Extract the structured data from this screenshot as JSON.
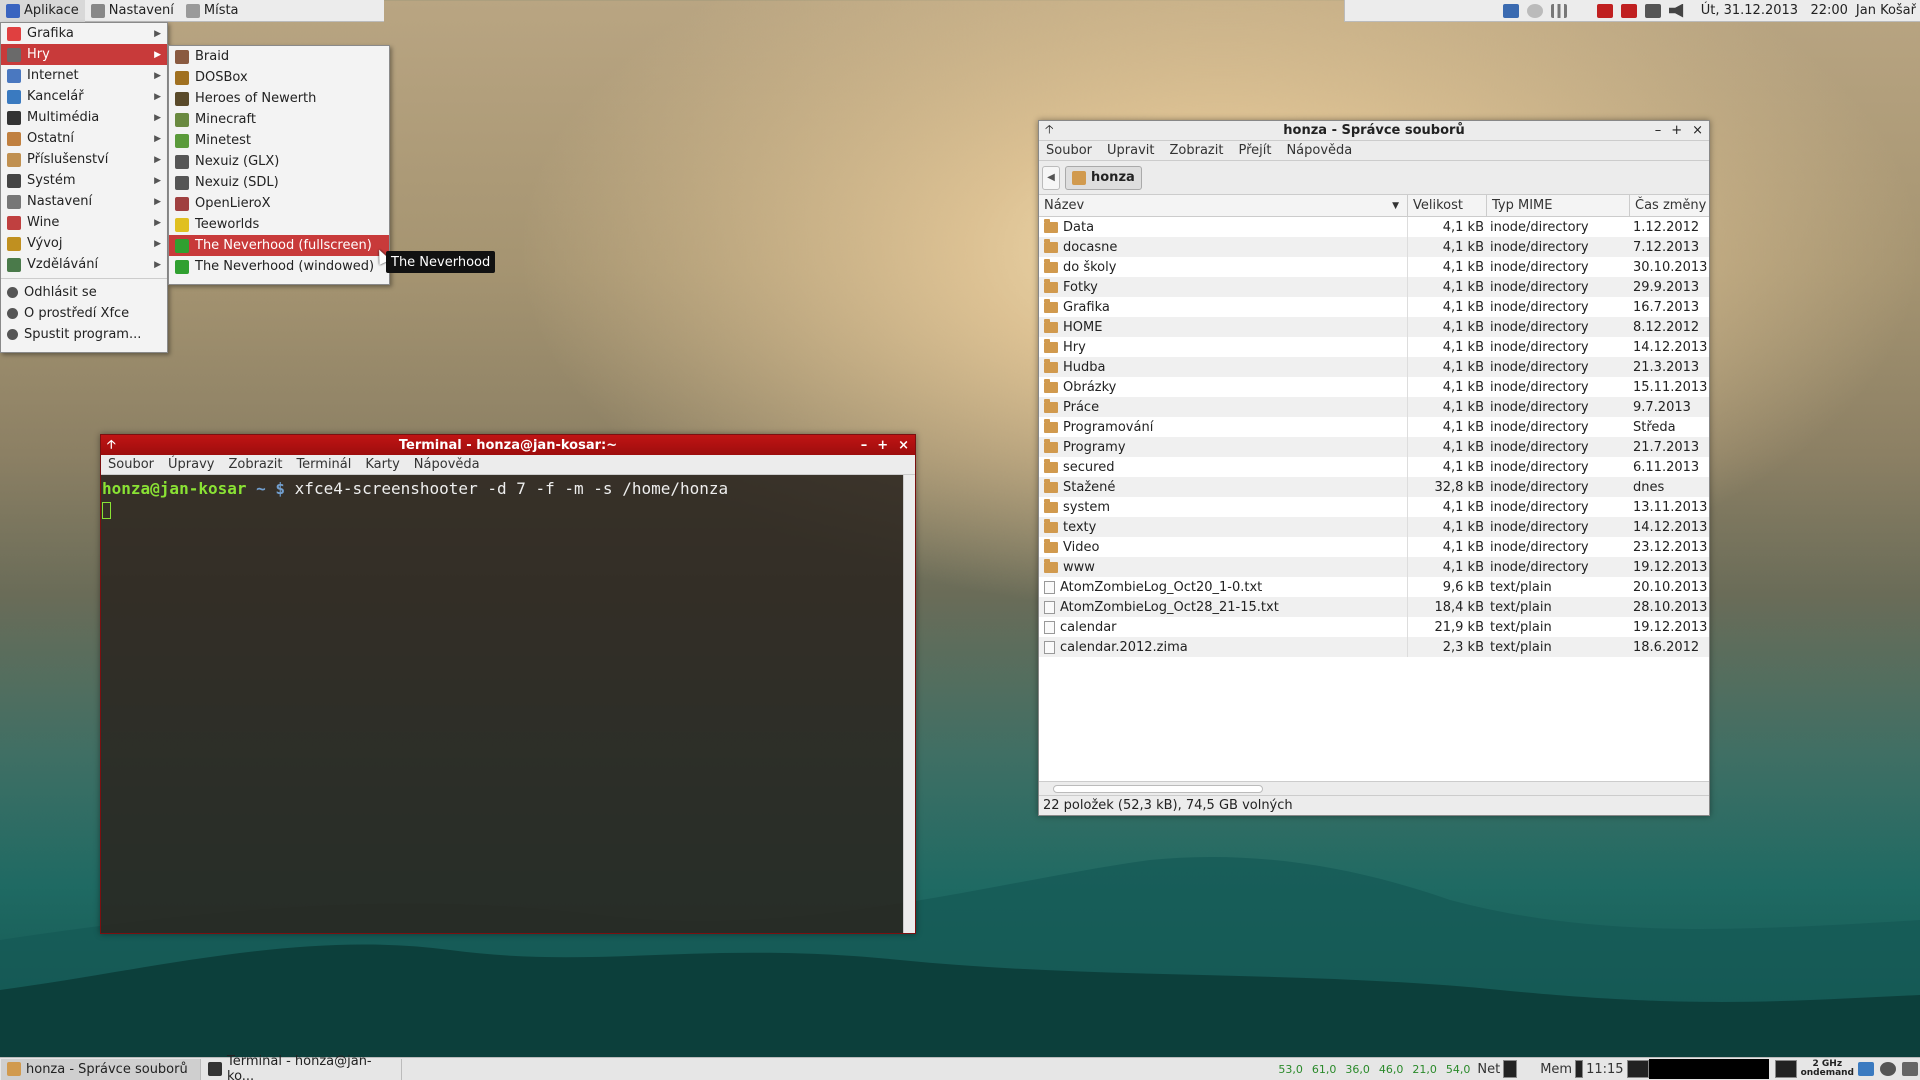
{
  "top_panel": {
    "applications": "Aplikace",
    "settings": "Nastavení",
    "places": "Místa",
    "datetime": "Út, 31.12.2013   22:00",
    "user": "Jan Košař"
  },
  "main_menu": {
    "items": [
      {
        "label": "Grafika",
        "icon": "graphics-icon",
        "color": "#e04040"
      },
      {
        "label": "Hry",
        "icon": "games-icon",
        "color": "#6a6a6a"
      },
      {
        "label": "Internet",
        "icon": "internet-icon",
        "color": "#4a78c0"
      },
      {
        "label": "Kancelář",
        "icon": "office-icon",
        "color": "#3a7ac0"
      },
      {
        "label": "Multimédia",
        "icon": "multimedia-icon",
        "color": "#333"
      },
      {
        "label": "Ostatní",
        "icon": "other-icon",
        "color": "#c08040"
      },
      {
        "label": "Příslušenství",
        "icon": "accessories-icon",
        "color": "#c09050"
      },
      {
        "label": "Systém",
        "icon": "system-icon",
        "color": "#444"
      },
      {
        "label": "Nastavení",
        "icon": "settings-icon",
        "color": "#777"
      },
      {
        "label": "Wine",
        "icon": "wine-icon",
        "color": "#c04040"
      },
      {
        "label": "Vývoj",
        "icon": "development-icon",
        "color": "#c09020"
      },
      {
        "label": "Vzdělávání",
        "icon": "education-icon",
        "color": "#4a7a4a"
      }
    ],
    "actions": [
      {
        "label": "Odhlásit se",
        "icon": "logout-icon"
      },
      {
        "label": "O prostředí Xfce",
        "icon": "about-icon"
      },
      {
        "label": "Spustit program...",
        "icon": "run-icon"
      }
    ]
  },
  "games_menu": {
    "items": [
      {
        "label": "Braid",
        "color": "#8a5a40"
      },
      {
        "label": "DOSBox",
        "color": "#a07020"
      },
      {
        "label": "Heroes of Newerth",
        "color": "#5a4a2a"
      },
      {
        "label": "Minecraft",
        "color": "#6a8a40"
      },
      {
        "label": "Minetest",
        "color": "#5a9a3a"
      },
      {
        "label": "Nexuiz (GLX)",
        "color": "#555"
      },
      {
        "label": "Nexuiz (SDL)",
        "color": "#555"
      },
      {
        "label": "OpenLieroX",
        "color": "#a04040"
      },
      {
        "label": "Teeworlds",
        "color": "#e0c020"
      },
      {
        "label": "The Neverhood (fullscreen)",
        "color": "#30a030"
      },
      {
        "label": "The Neverhood (windowed)",
        "color": "#30a030"
      }
    ]
  },
  "tooltip": "The Neverhood",
  "terminal": {
    "title": "Terminal - honza@jan-kosar:~",
    "menu": [
      "Soubor",
      "Úpravy",
      "Zobrazit",
      "Terminál",
      "Karty",
      "Nápověda"
    ],
    "prompt_user": "honza@jan-kosar",
    "prompt_path": " ~ $ ",
    "command": "xfce4-screenshooter -d 7 -f -m -s /home/honza"
  },
  "file_manager": {
    "title": "honza - Správce souborů",
    "menu": [
      "Soubor",
      "Upravit",
      "Zobrazit",
      "Přejít",
      "Nápověda"
    ],
    "location": "honza",
    "columns": [
      "Název",
      "Velikost",
      "Typ MIME",
      "Čas změny"
    ],
    "rows": [
      {
        "name": "Data",
        "size": "4,1 kB",
        "type": "inode/directory",
        "date": "1.12.2012",
        "kind": "folder"
      },
      {
        "name": "docasne",
        "size": "4,1 kB",
        "type": "inode/directory",
        "date": "7.12.2013",
        "kind": "folder"
      },
      {
        "name": "do školy",
        "size": "4,1 kB",
        "type": "inode/directory",
        "date": "30.10.2013",
        "kind": "folder"
      },
      {
        "name": "Fotky",
        "size": "4,1 kB",
        "type": "inode/directory",
        "date": "29.9.2013",
        "kind": "folder"
      },
      {
        "name": "Grafika",
        "size": "4,1 kB",
        "type": "inode/directory",
        "date": "16.7.2013",
        "kind": "folder"
      },
      {
        "name": "HOME",
        "size": "4,1 kB",
        "type": "inode/directory",
        "date": "8.12.2012",
        "kind": "folder"
      },
      {
        "name": "Hry",
        "size": "4,1 kB",
        "type": "inode/directory",
        "date": "14.12.2013",
        "kind": "folder"
      },
      {
        "name": "Hudba",
        "size": "4,1 kB",
        "type": "inode/directory",
        "date": "21.3.2013",
        "kind": "folder"
      },
      {
        "name": "Obrázky",
        "size": "4,1 kB",
        "type": "inode/directory",
        "date": "15.11.2013",
        "kind": "folder"
      },
      {
        "name": "Práce",
        "size": "4,1 kB",
        "type": "inode/directory",
        "date": "9.7.2013",
        "kind": "folder"
      },
      {
        "name": "Programování",
        "size": "4,1 kB",
        "type": "inode/directory",
        "date": "Středa",
        "kind": "folder"
      },
      {
        "name": "Programy",
        "size": "4,1 kB",
        "type": "inode/directory",
        "date": "21.7.2013",
        "kind": "folder"
      },
      {
        "name": "secured",
        "size": "4,1 kB",
        "type": "inode/directory",
        "date": "6.11.2013",
        "kind": "folder"
      },
      {
        "name": "Stažené",
        "size": "32,8 kB",
        "type": "inode/directory",
        "date": "dnes",
        "kind": "folder"
      },
      {
        "name": "system",
        "size": "4,1 kB",
        "type": "inode/directory",
        "date": "13.11.2013",
        "kind": "folder"
      },
      {
        "name": "texty",
        "size": "4,1 kB",
        "type": "inode/directory",
        "date": "14.12.2013",
        "kind": "folder"
      },
      {
        "name": "Video",
        "size": "4,1 kB",
        "type": "inode/directory",
        "date": "23.12.2013",
        "kind": "folder"
      },
      {
        "name": "www",
        "size": "4,1 kB",
        "type": "inode/directory",
        "date": "19.12.2013",
        "kind": "folder"
      },
      {
        "name": "AtomZombieLog_Oct20_1-0.txt",
        "size": "9,6 kB",
        "type": "text/plain",
        "date": "20.10.2013",
        "kind": "file"
      },
      {
        "name": "AtomZombieLog_Oct28_21-15.txt",
        "size": "18,4 kB",
        "type": "text/plain",
        "date": "28.10.2013",
        "kind": "file"
      },
      {
        "name": "calendar",
        "size": "21,9 kB",
        "type": "text/plain",
        "date": "19.12.2013",
        "kind": "file"
      },
      {
        "name": "calendar.2012.zima",
        "size": "2,3 kB",
        "type": "text/plain",
        "date": "18.6.2012",
        "kind": "file"
      }
    ],
    "status": "22 položek (52,3 kB), 74,5 GB volných"
  },
  "bottom_panel": {
    "tasks": [
      "honza - Správce souborů",
      "Terminal - honza@jan-ko..."
    ],
    "cpu": [
      "53,0",
      "61,0",
      "36,0",
      "46,0",
      "21,0",
      "54,0"
    ],
    "net": "Net",
    "mem": "Mem",
    "time": "11:15",
    "freq": "2 GHz",
    "governor": "ondemand"
  }
}
